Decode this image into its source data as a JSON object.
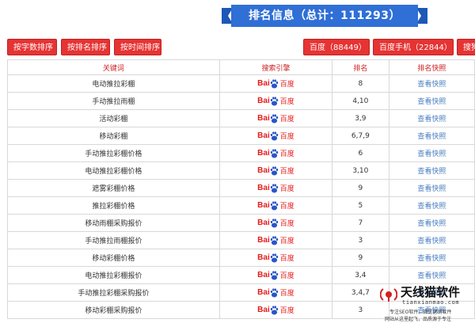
{
  "banner": {
    "title": "排名信息（总计：111293）"
  },
  "buttons": {
    "sort_by_word": "按字数排序",
    "sort_by_rank": "按排名排序",
    "sort_by_time": "按时间排序",
    "baidu_count": "百度（88449）",
    "baidu_mobile_count": "百度手机（22844）",
    "sogou_partial": "搜狗"
  },
  "table": {
    "headers": {
      "keyword": "关键词",
      "engine": "搜索引擎",
      "rank": "排名",
      "snapshot": "排名快照"
    },
    "rows": [
      {
        "keyword": "电动推拉彩棚",
        "rank": "8",
        "link": "查看快照"
      },
      {
        "keyword": "手动推拉雨棚",
        "rank": "4,10",
        "link": "查看快照"
      },
      {
        "keyword": "活动彩棚",
        "rank": "3,9",
        "link": "查看快照"
      },
      {
        "keyword": "移动彩棚",
        "rank": "6,7,9",
        "link": "查看快照"
      },
      {
        "keyword": "手动推拉彩棚价格",
        "rank": "6",
        "link": "查看快照"
      },
      {
        "keyword": "电动推拉彩棚价格",
        "rank": "3,10",
        "link": "查看快照"
      },
      {
        "keyword": "遮雾彩棚价格",
        "rank": "9",
        "link": "查看快照"
      },
      {
        "keyword": "推拉彩棚价格",
        "rank": "5",
        "link": "查看快照"
      },
      {
        "keyword": "移动雨棚采购报价",
        "rank": "7",
        "link": "查看快照"
      },
      {
        "keyword": "手动推拉雨棚报价",
        "rank": "3",
        "link": "查看快照"
      },
      {
        "keyword": "移动彩棚价格",
        "rank": "9",
        "link": "查看快照"
      },
      {
        "keyword": "电动推拉彩棚报价",
        "rank": "3,4",
        "link": "查看快照"
      },
      {
        "keyword": "手动推拉彩棚采购报价",
        "rank": "3,4,7",
        "link": "查看快照"
      },
      {
        "keyword": "移动彩棚采购报价",
        "rank": "3",
        "link": "查看快照"
      }
    ]
  },
  "engine_logo": {
    "left": "Bai",
    "right": "百度"
  },
  "watermark": {
    "name": "天线猫软件",
    "domain": "tianxianmao.com",
    "line1": "专注SEO软件，微信营销软件",
    "line2": "网站从这里起飞，品质源于专注"
  },
  "colors": {
    "accent_red": "#e63333",
    "banner_blue": "#2f6fd6",
    "link_blue": "#4a7fc1"
  }
}
